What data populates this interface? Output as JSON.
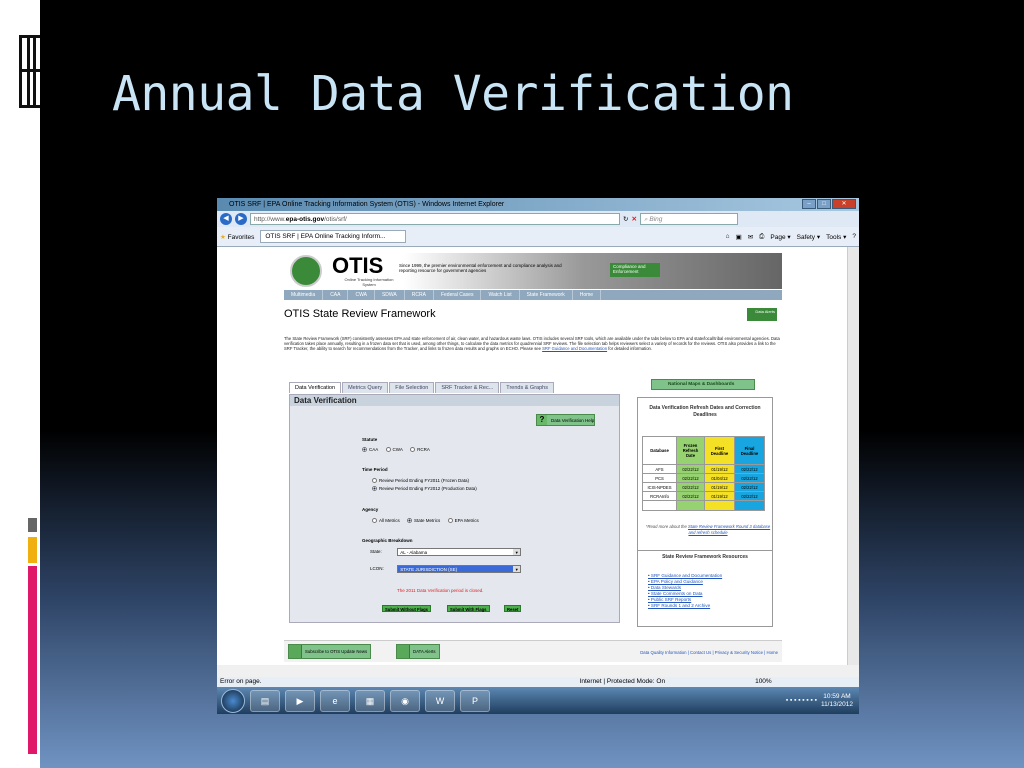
{
  "slide": {
    "title": "Annual Data Verification"
  },
  "browser": {
    "window_title": "OTIS SRF | EPA Online Tracking Information System (OTIS) - Windows Internet Explorer",
    "url_prefix": "http://www.",
    "url_domain": "epa-otis.gov",
    "url_path": "/otis/srf/",
    "search_placeholder": "Bing",
    "favorites_label": "Favorites",
    "tab_title": "OTIS SRF | EPA Online Tracking Inform...",
    "menu": {
      "page": "Page ▾",
      "safety": "Safety ▾",
      "tools": "Tools ▾"
    }
  },
  "site": {
    "logo": "OTIS",
    "logo_sub": "Online Tracking Information System",
    "tagline": "Since 1999, the premier environmental enforcement and compliance analysis and reporting resource for government agencies",
    "compliance_btn": "Compliance and Enforcement",
    "nav": [
      "Multimedia",
      "CAA",
      "CWA",
      "SDWA",
      "RCRA",
      "Federal Cases",
      "Watch List",
      "State Framework",
      "Home"
    ],
    "page_title": "OTIS State Review Framework",
    "data_alerts_btn": "Data Alerts",
    "intro": "The State Review Framework (SRF) consistently assesses EPA and state enforcement of air, clean water, and hazardous waste laws. OTIS includes several SRF tools, which are available under the tabs below to EPA and state/local/tribal environmental agencies. Data verification takes place annually, resulting in a frozen data set that is used, among other things, to calculate the data metrics for quadrennial SRF reviews. The file selection tab helps reviewers select a variety of records for the reviews. OTIS also provides a link to the SRF Tracker, the ability to search for recommendations from the Tracker, and links to frozen data results and graphs on ECHO. Please see",
    "intro_link": "SRF Guidance and Documentation",
    "intro_end": "for detailed information."
  },
  "tabs": [
    "Data Verification",
    "Metrics Query",
    "File Selection",
    "SRF Tracker & Rec...",
    "Trends & Graphs"
  ],
  "form": {
    "heading": "Data Verification",
    "help_btn": "Data Verification Help",
    "statute_label": "Statute",
    "statute_options": [
      "CAA",
      "CWA",
      "RCRA"
    ],
    "statute_selected": "CAA",
    "period_label": "Time Period",
    "period_options": [
      "Review Period Ending FY2011 (Frozen Data)",
      "Review Period Ending FY2012 (Production Data)"
    ],
    "period_selected": "Review Period Ending FY2012 (Production Data)",
    "agency_label": "Agency",
    "agency_options": [
      "All Metrics",
      "State Metrics",
      "EPA Metrics"
    ],
    "agency_selected": "State Metrics",
    "geo_label": "Geographic Breakdown",
    "state_label": "State:",
    "state_value": "AL - Alabama",
    "lcon_label": "LCON:",
    "lcon_value": "STATE JURISDICTION (SE)",
    "closed_msg": "The 2011 Data Verification period is closed.",
    "buttons": [
      "Submit Without Flags",
      "Submit With Flags",
      "Reset"
    ]
  },
  "right": {
    "maps_btn": "National Maps & Dashboards",
    "deadlines_title": "Data Verification Refresh Dates and Correction Deadlines",
    "table_headers": [
      "Database",
      "Frozen Refresh Date",
      "First Deadline",
      "Final Deadline"
    ],
    "table_rows": [
      [
        "AFS",
        "02/22/12",
        "01/19/12",
        "02/22/12"
      ],
      [
        "PCS",
        "02/22/12",
        "01/04/12",
        "02/22/12"
      ],
      [
        "ICIS-NPDES",
        "02/22/12",
        "01/19/12",
        "02/22/12"
      ],
      [
        "RCRAInfo",
        "02/22/12",
        "01/19/12",
        "02/22/12"
      ]
    ],
    "note_pre": "*Read more about the",
    "note_link": "State Review Framework Round 3 database and refresh schedule",
    "resources_title": "State Review Framework Resources",
    "resources": [
      "SRF Guidance and Documentation",
      "EPA Policy and Guidance",
      "Data Stewards",
      "State Comments on Data",
      "Public SRF Reports",
      "SRF Rounds 1 and 2 Archive"
    ]
  },
  "footer": {
    "subscribe_btn": "Subscribe to OTIS Update News",
    "alerts_btn": "DATA Alerts",
    "links": "Data Quality Information | Contact Us | Privacy & Security Notice | Home"
  },
  "statusbar": {
    "left": "Error on page.",
    "zone": "Internet | Protected Mode: On",
    "zoom": "100%"
  },
  "taskbar": {
    "time": "10:59 AM",
    "date": "11/13/2012"
  }
}
